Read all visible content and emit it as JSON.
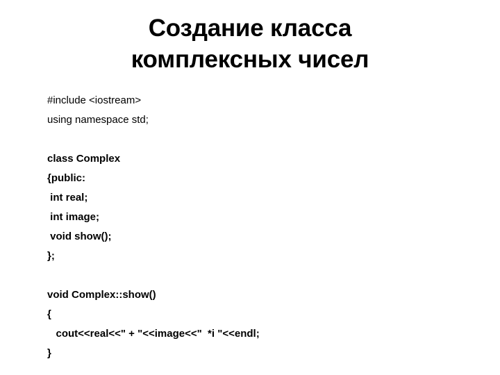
{
  "slide": {
    "background_color": "#ffffff",
    "text_color": "#000000",
    "title": {
      "line1": "Создание класса",
      "line2": "комплексных чисел"
    },
    "code": {
      "language": "cpp",
      "lines": [
        {
          "text": "#include <iostream>",
          "bold": false
        },
        {
          "text": "using namespace std;",
          "bold": false
        },
        {
          "text": "",
          "bold": false
        },
        {
          "text": "class Complex",
          "bold": true
        },
        {
          "text": "{public:",
          "bold": true
        },
        {
          "text": " int real;",
          "bold": true
        },
        {
          "text": " int image;",
          "bold": true
        },
        {
          "text": " void show();",
          "bold": true
        },
        {
          "text": "};",
          "bold": true
        },
        {
          "text": "",
          "bold": true
        },
        {
          "text": "void Complex::show()",
          "bold": true
        },
        {
          "text": "{",
          "bold": true
        },
        {
          "text": "   cout<<real<<\" + \"<<image<<\"  *i \"<<endl;",
          "bold": true
        },
        {
          "text": "}",
          "bold": true
        }
      ]
    }
  }
}
